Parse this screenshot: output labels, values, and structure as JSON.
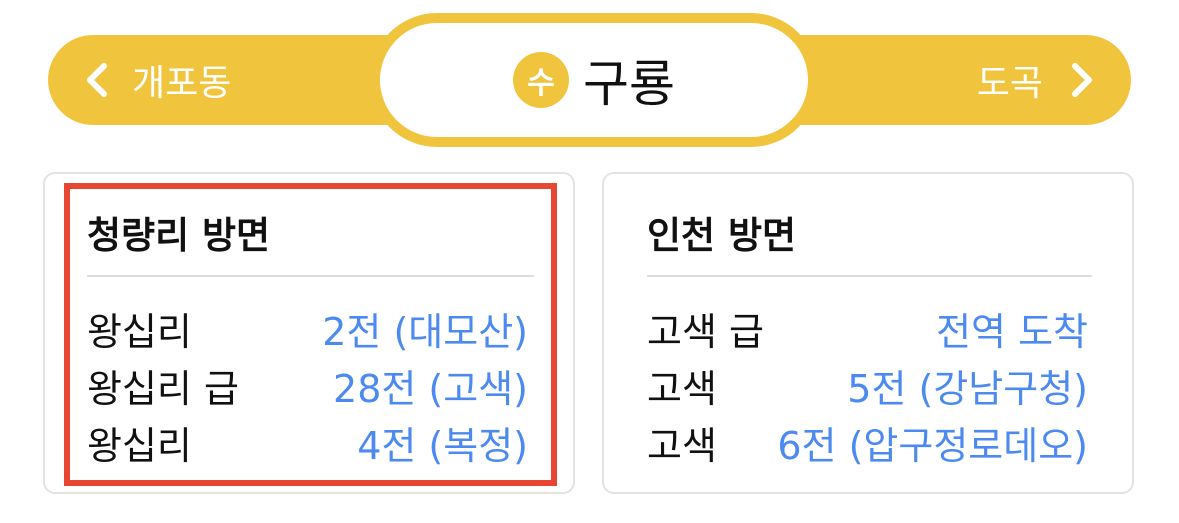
{
  "nav": {
    "prev_station": "개포동",
    "current_station": "구룡",
    "line_badge": "수",
    "next_station": "도곡"
  },
  "colors": {
    "line_color": "#f0c43c",
    "arrival_text": "#4d8af0",
    "highlight_border": "#e64632"
  },
  "directions": [
    {
      "title": "청량리 방면",
      "arrivals": [
        {
          "train": "왕십리",
          "status": "2전 (대모산)"
        },
        {
          "train": "왕십리 급",
          "status": "28전 (고색)"
        },
        {
          "train": "왕십리",
          "status": "4전 (복정)"
        }
      ]
    },
    {
      "title": "인천 방면",
      "arrivals": [
        {
          "train": "고색 급",
          "status": "전역 도착"
        },
        {
          "train": "고색",
          "status": "5전 (강남구청)"
        },
        {
          "train": "고색",
          "status": "6전 (압구정로데오)"
        }
      ]
    }
  ]
}
